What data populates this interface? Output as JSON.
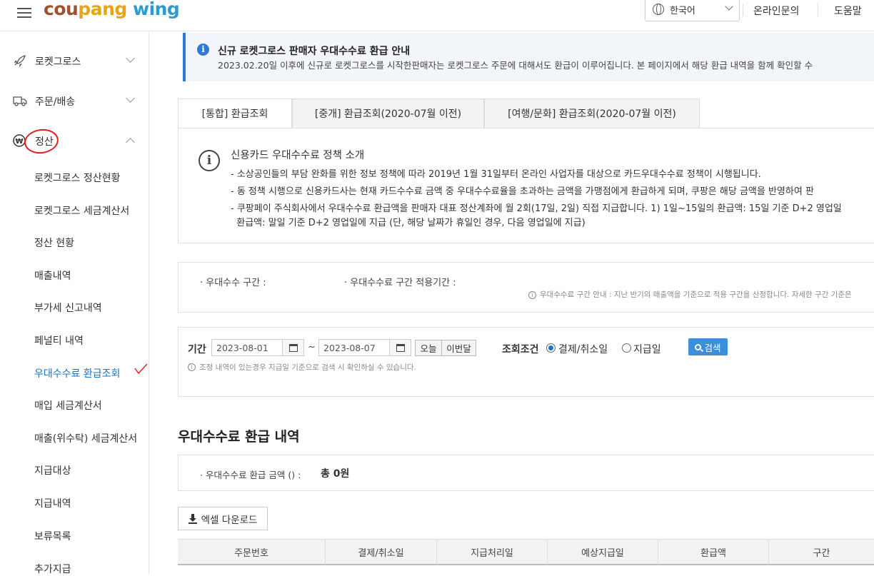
{
  "header": {
    "logo_part1": "cou",
    "logo_part2": "pang",
    "logo_part3": " wing",
    "language": "한국어",
    "links": [
      "온라인문의",
      "도움말"
    ]
  },
  "sidebar": {
    "groups": [
      {
        "label": "로켓그로스",
        "icon": "rocket-icon"
      },
      {
        "label": "주문/배송",
        "icon": "truck-icon"
      },
      {
        "label": "정산",
        "icon": "won-coin-icon"
      }
    ],
    "items": [
      "로켓그로스 정산현황",
      "로켓그로스 세금계산서",
      "정산 현황",
      "매출내역",
      "부가세 신고내역",
      "페널티 내역",
      "우대수수료 환급조회",
      "매입 세금계산서",
      "매출(위수탁) 세금계산서",
      "지급대상",
      "지급내역",
      "보류목록",
      "추가지급"
    ],
    "active_item": "우대수수료 환급조회"
  },
  "notice": {
    "title": "신규 로켓그로스 판매자 우대수수료 환급 안내",
    "text": "2023.02.20일 이후에 신규로 로켓그로스를 시작한판매자는 로켓그로스 주문에 대해서도 환급이 이루어집니다. 본 페이지에서 해당 환급 내역을 함께 확인할 수"
  },
  "tabs": [
    "[통합] 환급조회",
    "[중개] 환급조회(2020-07월 이전)",
    "[여행/문화] 환급조회(2020-07월 이전)"
  ],
  "policy": {
    "title": "신용카드 우대수수료 정책 소개",
    "lines": [
      "- 소상공인들의 부담 완화를 위한 정보 정책에 따라 2019년 1월 31일부터 온라인 사업자를 대상으로 카드우대수수료 정책이 시행됩니다.",
      "- 동 정책 시행으로 신용카드사는 현재 카드수수료 금액 중 우대수수료율을 초과하는 금액을 가맹점에게 환급하게 되며, 쿠팡은 해당 금액을 반영하여 판",
      "- 쿠팡페이 주식회사에서 우대수수료 환급액을 판매자 대표 정산계좌에 월 2회(17일, 2일) 직접 지급합니다. 1) 1일~15일의 환급액: 15일 기준 D+2 영업일",
      "  환급액: 말일 기준 D+2 영업일에 지급 (단, 해당 날짜가 휴일인 경우, 다음 영업일에 지급)"
    ]
  },
  "tier": {
    "range_label": "· 우대수수 구간 :",
    "period_label": "· 우대수수료 구간 적용기간 :",
    "note": "우대수수료 구간 안내 : 지난 반기의 매출액을 기준으로 적용 구간을 산정합니다. 자세한 구간 기준은"
  },
  "filter": {
    "period_label": "기간",
    "start_date": "2023-08-01",
    "tilde": "~",
    "end_date": "2023-08-07",
    "today_label": "오늘",
    "this_month_label": "이번달",
    "condition_label": "조회조건",
    "radio_options": [
      "결제/취소일",
      "지급일"
    ],
    "selected_radio": "결제/취소일",
    "search_label": "검색",
    "note": "조정 내역이 있는경우 지급일 기준으로 검색 시 확인하실 수 있습니다."
  },
  "results": {
    "title": "우대수수료 환급 내역",
    "total_label": "· 우대수수료 환급 금액 () :",
    "total_value": "총 0원",
    "excel_label": "엑셀 다운로드",
    "columns": [
      "주문번호",
      "결제/취소일",
      "지급처리일",
      "예상지급일",
      "환급액",
      "구간"
    ]
  },
  "colors": {
    "accent": "#2d7ad6",
    "active_link": "#1a73c7",
    "annotation_red": "#e02020"
  }
}
